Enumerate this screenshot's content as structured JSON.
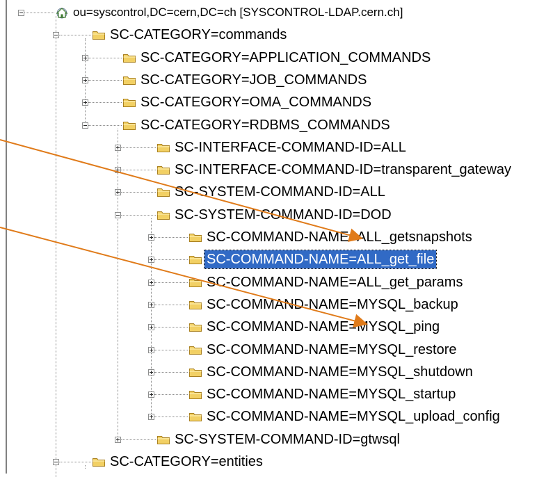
{
  "tree": {
    "nodes": [
      {
        "label": "ou=syscontrol,DC=cern,DC=ch [SYSCONTROL-LDAP.cern.ch]",
        "depth": 0,
        "state": "expanded",
        "icon": "ldap-server-icon"
      },
      {
        "label": "SC-CATEGORY=commands",
        "depth": 1,
        "state": "expanded",
        "icon": "folder-icon"
      },
      {
        "label": "SC-CATEGORY=APPLICATION_COMMANDS",
        "depth": 2,
        "state": "collapsed",
        "icon": "folder-icon"
      },
      {
        "label": "SC-CATEGORY=JOB_COMMANDS",
        "depth": 2,
        "state": "collapsed",
        "icon": "folder-icon"
      },
      {
        "label": "SC-CATEGORY=OMA_COMMANDS",
        "depth": 2,
        "state": "collapsed",
        "icon": "folder-icon"
      },
      {
        "label": "SC-CATEGORY=RDBMS_COMMANDS",
        "depth": 2,
        "state": "expanded",
        "icon": "folder-icon"
      },
      {
        "label": "SC-INTERFACE-COMMAND-ID=ALL",
        "depth": 3,
        "state": "collapsed",
        "icon": "folder-icon"
      },
      {
        "label": "SC-INTERFACE-COMMAND-ID=transparent_gateway",
        "depth": 3,
        "state": "collapsed",
        "icon": "folder-icon"
      },
      {
        "label": "SC-SYSTEM-COMMAND-ID=ALL",
        "depth": 3,
        "state": "collapsed",
        "icon": "folder-icon"
      },
      {
        "label": "SC-SYSTEM-COMMAND-ID=DOD",
        "depth": 3,
        "state": "expanded",
        "icon": "folder-icon"
      },
      {
        "label": "SC-COMMAND-NAME=ALL_getsnapshots",
        "depth": 4,
        "state": "collapsed",
        "icon": "folder-icon"
      },
      {
        "label": "SC-COMMAND-NAME=ALL_get_file",
        "depth": 4,
        "state": "collapsed",
        "icon": "folder-icon",
        "selected": true
      },
      {
        "label": "SC-COMMAND-NAME=ALL_get_params",
        "depth": 4,
        "state": "collapsed",
        "icon": "folder-icon"
      },
      {
        "label": "SC-COMMAND-NAME=MYSQL_backup",
        "depth": 4,
        "state": "collapsed",
        "icon": "folder-icon"
      },
      {
        "label": "SC-COMMAND-NAME=MYSQL_ping",
        "depth": 4,
        "state": "collapsed",
        "icon": "folder-icon"
      },
      {
        "label": "SC-COMMAND-NAME=MYSQL_restore",
        "depth": 4,
        "state": "collapsed",
        "icon": "folder-icon"
      },
      {
        "label": "SC-COMMAND-NAME=MYSQL_shutdown",
        "depth": 4,
        "state": "collapsed",
        "icon": "folder-icon"
      },
      {
        "label": "SC-COMMAND-NAME=MYSQL_startup",
        "depth": 4,
        "state": "collapsed",
        "icon": "folder-icon"
      },
      {
        "label": "SC-COMMAND-NAME=MYSQL_upload_config",
        "depth": 4,
        "state": "collapsed",
        "icon": "folder-icon"
      },
      {
        "label": "SC-SYSTEM-COMMAND-ID=gtwsql",
        "depth": 3,
        "state": "collapsed",
        "icon": "folder-icon"
      },
      {
        "label": "SC-CATEGORY=entities",
        "depth": 1,
        "state": "expanded",
        "icon": "folder-icon"
      }
    ]
  },
  "annotations": {
    "arrow_color": "#e07b1a",
    "arrows": [
      {
        "name": "callout-arrow-getsnapshots",
        "target": "SC-COMMAND-NAME=ALL_getsnapshots"
      },
      {
        "name": "callout-arrow-mysql-ping",
        "target": "SC-COMMAND-NAME=MYSQL_ping"
      }
    ]
  },
  "colors": {
    "selection": "#316ac5",
    "folder_fill": "#f2d064",
    "folder_stroke": "#a9801f"
  }
}
